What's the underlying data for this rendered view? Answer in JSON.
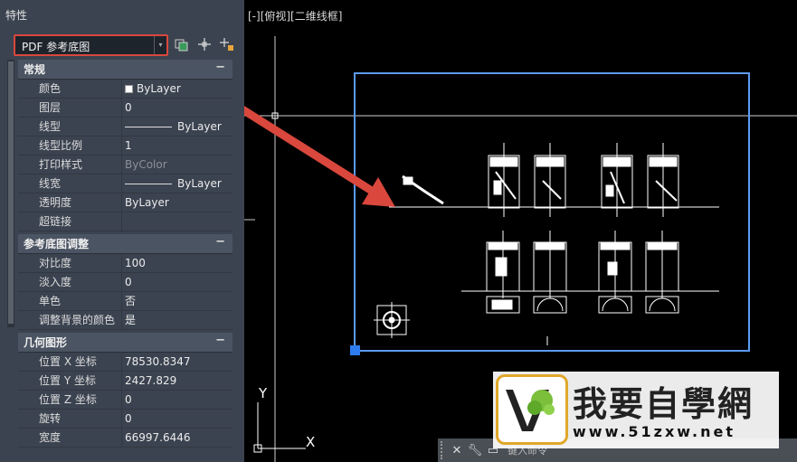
{
  "palette": {
    "title": "特性",
    "object_type": "PDF 参考底图"
  },
  "sections": {
    "general": {
      "title": "常规",
      "rows": [
        {
          "label": "颜色",
          "value": "ByLayer"
        },
        {
          "label": "图层",
          "value": "0"
        },
        {
          "label": "线型",
          "value": "ByLayer"
        },
        {
          "label": "线型比例",
          "value": "1"
        },
        {
          "label": "打印样式",
          "value": "ByColor"
        },
        {
          "label": "线宽",
          "value": "ByLayer"
        },
        {
          "label": "透明度",
          "value": "ByLayer"
        },
        {
          "label": "超链接",
          "value": ""
        }
      ]
    },
    "underlay": {
      "title": "参考底图调整",
      "rows": [
        {
          "label": "对比度",
          "value": "100"
        },
        {
          "label": "淡入度",
          "value": "0"
        },
        {
          "label": "单色",
          "value": "否"
        },
        {
          "label": "调整背景的颜色",
          "value": "是"
        }
      ]
    },
    "geometry": {
      "title": "几何图形",
      "rows": [
        {
          "label": "位置 X 坐标",
          "value": "78530.8347"
        },
        {
          "label": "位置 Y 坐标",
          "value": "2427.829"
        },
        {
          "label": "位置 Z 坐标",
          "value": "0"
        },
        {
          "label": "旋转",
          "value": "0"
        },
        {
          "label": "宽度",
          "value": "66997.6446"
        }
      ]
    }
  },
  "viewport": {
    "view_label": "[-][俯视][二维线框]",
    "ucs_x": "X",
    "ucs_y": "Y"
  },
  "cmdline": {
    "input_text": "键入命令"
  },
  "watermark": {
    "cn": "我要自學網",
    "url": "www.51zxw.net"
  },
  "colors": {
    "highlight": "#d9473d",
    "selection": "#5b9bf2",
    "palette_bg": "#3b4350"
  },
  "icons": [
    "quick-select-icon",
    "select-objects-icon",
    "toggle-pickadd-icon",
    "close-icon",
    "wrench-icon",
    "command-prompt-icon"
  ]
}
